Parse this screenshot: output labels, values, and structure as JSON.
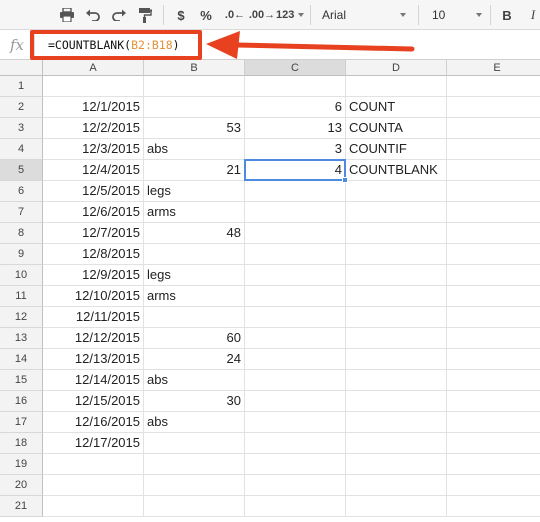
{
  "toolbar": {
    "currency_label": "$",
    "percent_label": "%",
    "decrease_decimals_label": ".0←",
    "increase_decimals_label": ".00→",
    "number_format_label": "123",
    "font_family_value": "Arial",
    "font_size_value": "10",
    "bold_label": "B",
    "italic_label": "I"
  },
  "formula_bar": {
    "fx_label": "fx",
    "formula_prefix": "=COUNTBLANK(",
    "formula_range": "B2:B18",
    "formula_suffix": ")"
  },
  "sheet": {
    "columns": [
      "A",
      "B",
      "C",
      "D",
      "E"
    ],
    "selected_column": "C",
    "selected_row": "5",
    "selected_cell": "C5",
    "rows": [
      {
        "num": "1",
        "A": "",
        "B": "",
        "C": "",
        "D": ""
      },
      {
        "num": "2",
        "A": "12/1/2015",
        "B": "",
        "C": "6",
        "D": "COUNT"
      },
      {
        "num": "3",
        "A": "12/2/2015",
        "B": "53",
        "C": "13",
        "D": "COUNTA"
      },
      {
        "num": "4",
        "A": "12/3/2015",
        "B": "abs",
        "C": "3",
        "D": "COUNTIF"
      },
      {
        "num": "5",
        "A": "12/4/2015",
        "B": "21",
        "C": "4",
        "D": "COUNTBLANK"
      },
      {
        "num": "6",
        "A": "12/5/2015",
        "B": "legs",
        "C": "",
        "D": ""
      },
      {
        "num": "7",
        "A": "12/6/2015",
        "B": "arms",
        "C": "",
        "D": ""
      },
      {
        "num": "8",
        "A": "12/7/2015",
        "B": "48",
        "C": "",
        "D": ""
      },
      {
        "num": "9",
        "A": "12/8/2015",
        "B": "",
        "C": "",
        "D": ""
      },
      {
        "num": "10",
        "A": "12/9/2015",
        "B": "legs",
        "C": "",
        "D": ""
      },
      {
        "num": "11",
        "A": "12/10/2015",
        "B": "arms",
        "C": "",
        "D": ""
      },
      {
        "num": "12",
        "A": "12/11/2015",
        "B": "",
        "C": "",
        "D": ""
      },
      {
        "num": "13",
        "A": "12/12/2015",
        "B": "60",
        "C": "",
        "D": ""
      },
      {
        "num": "14",
        "A": "12/13/2015",
        "B": "24",
        "C": "",
        "D": ""
      },
      {
        "num": "15",
        "A": "12/14/2015",
        "B": "abs",
        "C": "",
        "D": ""
      },
      {
        "num": "16",
        "A": "12/15/2015",
        "B": "30",
        "C": "",
        "D": ""
      },
      {
        "num": "17",
        "A": "12/16/2015",
        "B": "abs",
        "C": "",
        "D": ""
      },
      {
        "num": "18",
        "A": "12/17/2015",
        "B": "",
        "C": "",
        "D": ""
      },
      {
        "num": "19",
        "A": "",
        "B": "",
        "C": "",
        "D": ""
      },
      {
        "num": "20",
        "A": "",
        "B": "",
        "C": "",
        "D": ""
      },
      {
        "num": "21",
        "A": "",
        "B": "",
        "C": "",
        "D": ""
      }
    ]
  },
  "annotation": {
    "color": "#e8411f",
    "arrow_icon": "arrow-left-icon"
  },
  "colors": {
    "selection": "#4d8ae0",
    "formula_range": "#e69138"
  }
}
